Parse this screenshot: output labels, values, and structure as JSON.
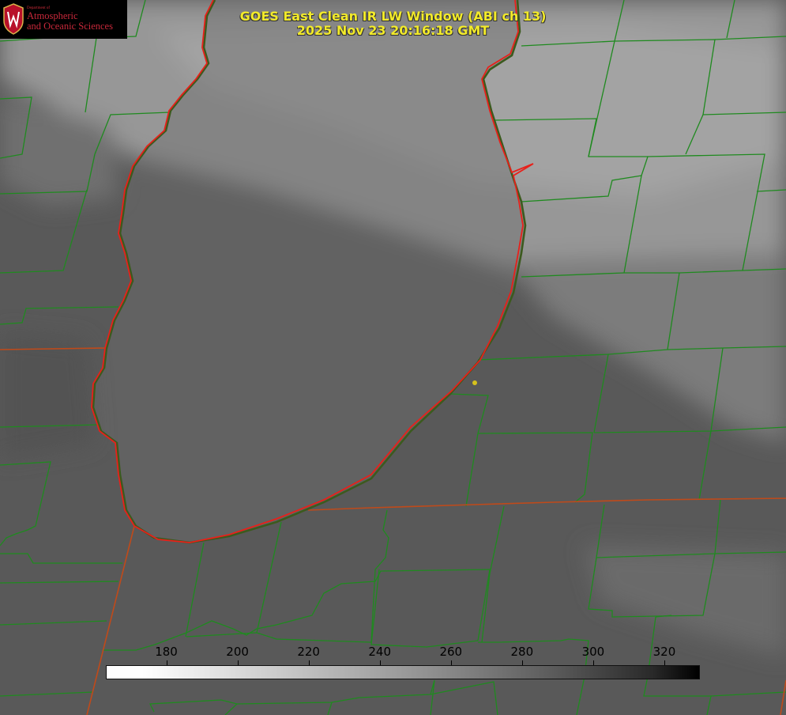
{
  "title": {
    "line1": "GOES East Clean IR LW Window (ABI ch 13)",
    "line2": "2025 Nov 23 20:16:18 GMT"
  },
  "logo": {
    "dept": "Department of",
    "line1": "Atmospheric",
    "line2": "and Oceanic Sciences",
    "seal_letter": "W"
  },
  "colorbar": {
    "ticks": [
      "180",
      "200",
      "220",
      "240",
      "260",
      "280",
      "300",
      "320"
    ],
    "tick_values": [
      180,
      200,
      220,
      240,
      260,
      280,
      300,
      320
    ],
    "range": [
      163,
      330
    ]
  },
  "colors": {
    "title": "#f2ea2a",
    "lake_outline": "#e8201a",
    "county_lines": "#1f8a1f",
    "state_lines": "#c04a1a",
    "marker": "#d6c21c"
  }
}
